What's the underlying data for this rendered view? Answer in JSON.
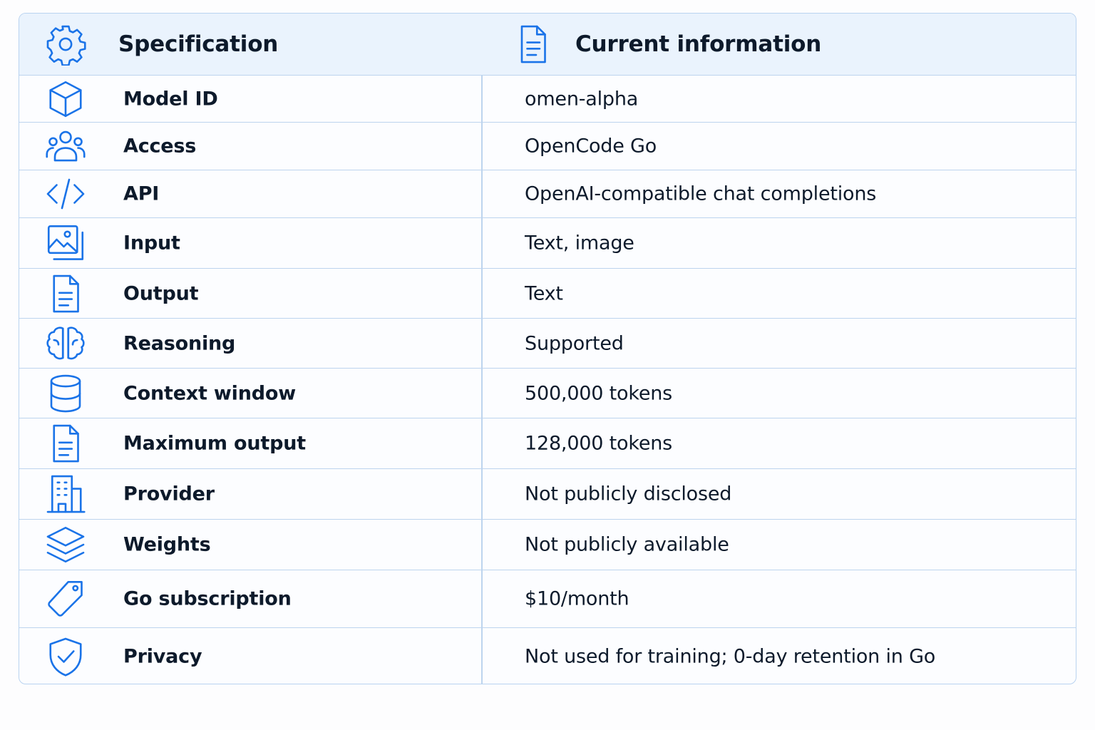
{
  "header": {
    "spec_label": "Specification",
    "info_label": "Current information",
    "spec_icon": "gear-icon",
    "info_icon": "document-icon"
  },
  "rows": [
    {
      "label": "Model ID",
      "value": "omen-alpha",
      "icon": "cube-icon"
    },
    {
      "label": "Access",
      "value": "OpenCode Go",
      "icon": "users-icon"
    },
    {
      "label": "API",
      "value": "OpenAI-compatible chat completions",
      "icon": "code-icon"
    },
    {
      "label": "Input",
      "value": "Text, image",
      "icon": "image-icon"
    },
    {
      "label": "Output",
      "value": "Text",
      "icon": "document-icon"
    },
    {
      "label": "Reasoning",
      "value": "Supported",
      "icon": "brain-icon"
    },
    {
      "label": "Context window",
      "value": "500,000 tokens",
      "icon": "database-icon"
    },
    {
      "label": "Maximum output",
      "value": "128,000 tokens",
      "icon": "document-icon"
    },
    {
      "label": "Provider",
      "value": "Not publicly disclosed",
      "icon": "building-icon"
    },
    {
      "label": "Weights",
      "value": "Not publicly available",
      "icon": "layers-icon"
    },
    {
      "label": "Go subscription",
      "value": "$10/month",
      "icon": "tag-icon"
    },
    {
      "label": "Privacy",
      "value": "Not used for training; 0-day retention in Go",
      "icon": "shield-check-icon"
    }
  ],
  "colors": {
    "accent": "#1a73e8",
    "border": "#bdd4ee",
    "header_bg": "#eaf3fd",
    "text": "#0d1a2b"
  }
}
